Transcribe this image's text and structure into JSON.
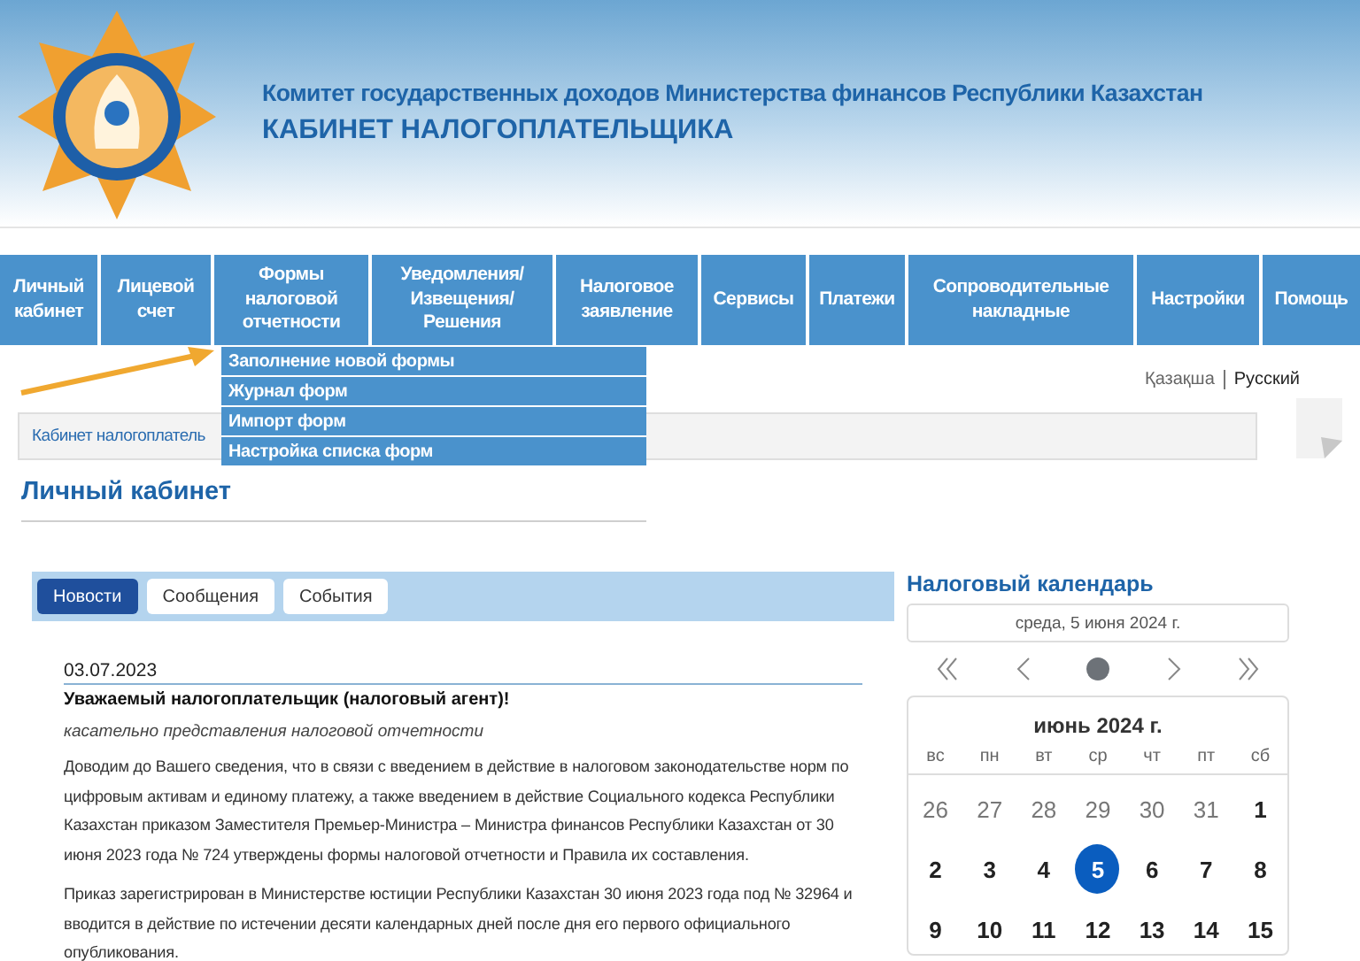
{
  "header": {
    "subtitle": "Комитет государственных доходов Министерства финансов Республики Казахстан",
    "title": "КАБИНЕТ НАЛОГОПЛАТЕЛЬЩИКА"
  },
  "nav": {
    "items": [
      {
        "label": "Личный кабинет"
      },
      {
        "label": "Лицевой счет"
      },
      {
        "label": "Формы налоговой отчетности",
        "dropdown": [
          "Заполнение новой формы",
          "Журнал форм",
          "Импорт форм",
          "Настройка списка форм"
        ]
      },
      {
        "label": "Уведомления/ Извещения/ Решения"
      },
      {
        "label": "Налоговое заявление"
      },
      {
        "label": "Сервисы"
      },
      {
        "label": "Платежи"
      },
      {
        "label": "Сопроводительные накладные"
      },
      {
        "label": "Настройки"
      },
      {
        "label": "Помощь"
      }
    ]
  },
  "languages": [
    {
      "label": "Қазақша",
      "selected": false
    },
    {
      "label": "Русский",
      "selected": true
    }
  ],
  "breadcrumb": "Кабинет налогоплатель",
  "page_title": "Личный кабинет",
  "news": {
    "tabs": [
      {
        "label": "Новости",
        "selected": true
      },
      {
        "label": "Сообщения",
        "selected": false
      },
      {
        "label": "События",
        "selected": false
      }
    ],
    "date": "03.07.2023",
    "headline": "Уважаемый налогоплательщик (налоговый агент)!",
    "subject": "касательно представления налоговой отчетности",
    "paragraphs": [
      "Доводим до Вашего сведения, что в связи с введением в действие в налоговом законодательстве норм по цифровым активам и единому платежу, а также введением в действие Социального кодекса Республики Казахстан приказом Заместителя Премьер-Министра – Министра финансов Республики Казахстан от 30 июня 2023 года № 724 утверждены формы налоговой отчетности и Правила их составления.",
      "Приказ зарегистрирован в Министерстве юстиции Республики Казахстан 30 июня 2023 года под № 32964 и вводится в действие по истечении десяти календарных дней после дня его первого официального опубликования."
    ]
  },
  "calendar": {
    "title": "Налоговый календарь",
    "current_date": "среда, 5 июня 2024 г.",
    "month": "июнь 2024 г.",
    "weekdays": [
      "вс",
      "пн",
      "вт",
      "ср",
      "чт",
      "пт",
      "сб"
    ],
    "days": [
      {
        "label": "26",
        "other_month": true,
        "selected": false
      },
      {
        "label": "27",
        "other_month": true,
        "selected": false
      },
      {
        "label": "28",
        "other_month": true,
        "selected": false
      },
      {
        "label": "29",
        "other_month": true,
        "selected": false
      },
      {
        "label": "30",
        "other_month": true,
        "selected": false
      },
      {
        "label": "31",
        "other_month": true,
        "selected": false
      },
      {
        "label": "1",
        "other_month": false,
        "selected": false
      },
      {
        "label": "2",
        "other_month": false,
        "selected": false
      },
      {
        "label": "3",
        "other_month": false,
        "selected": false
      },
      {
        "label": "4",
        "other_month": false,
        "selected": false
      },
      {
        "label": "5",
        "other_month": false,
        "selected": true
      },
      {
        "label": "6",
        "other_month": false,
        "selected": false
      },
      {
        "label": "7",
        "other_month": false,
        "selected": false
      },
      {
        "label": "8",
        "other_month": false,
        "selected": false
      },
      {
        "label": "9",
        "other_month": false,
        "selected": false
      },
      {
        "label": "10",
        "other_month": false,
        "selected": false
      },
      {
        "label": "11",
        "other_month": false,
        "selected": false
      },
      {
        "label": "12",
        "other_month": false,
        "selected": false
      },
      {
        "label": "13",
        "other_month": false,
        "selected": false
      },
      {
        "label": "14",
        "other_month": false,
        "selected": false
      },
      {
        "label": "15",
        "other_month": false,
        "selected": false
      }
    ]
  }
}
